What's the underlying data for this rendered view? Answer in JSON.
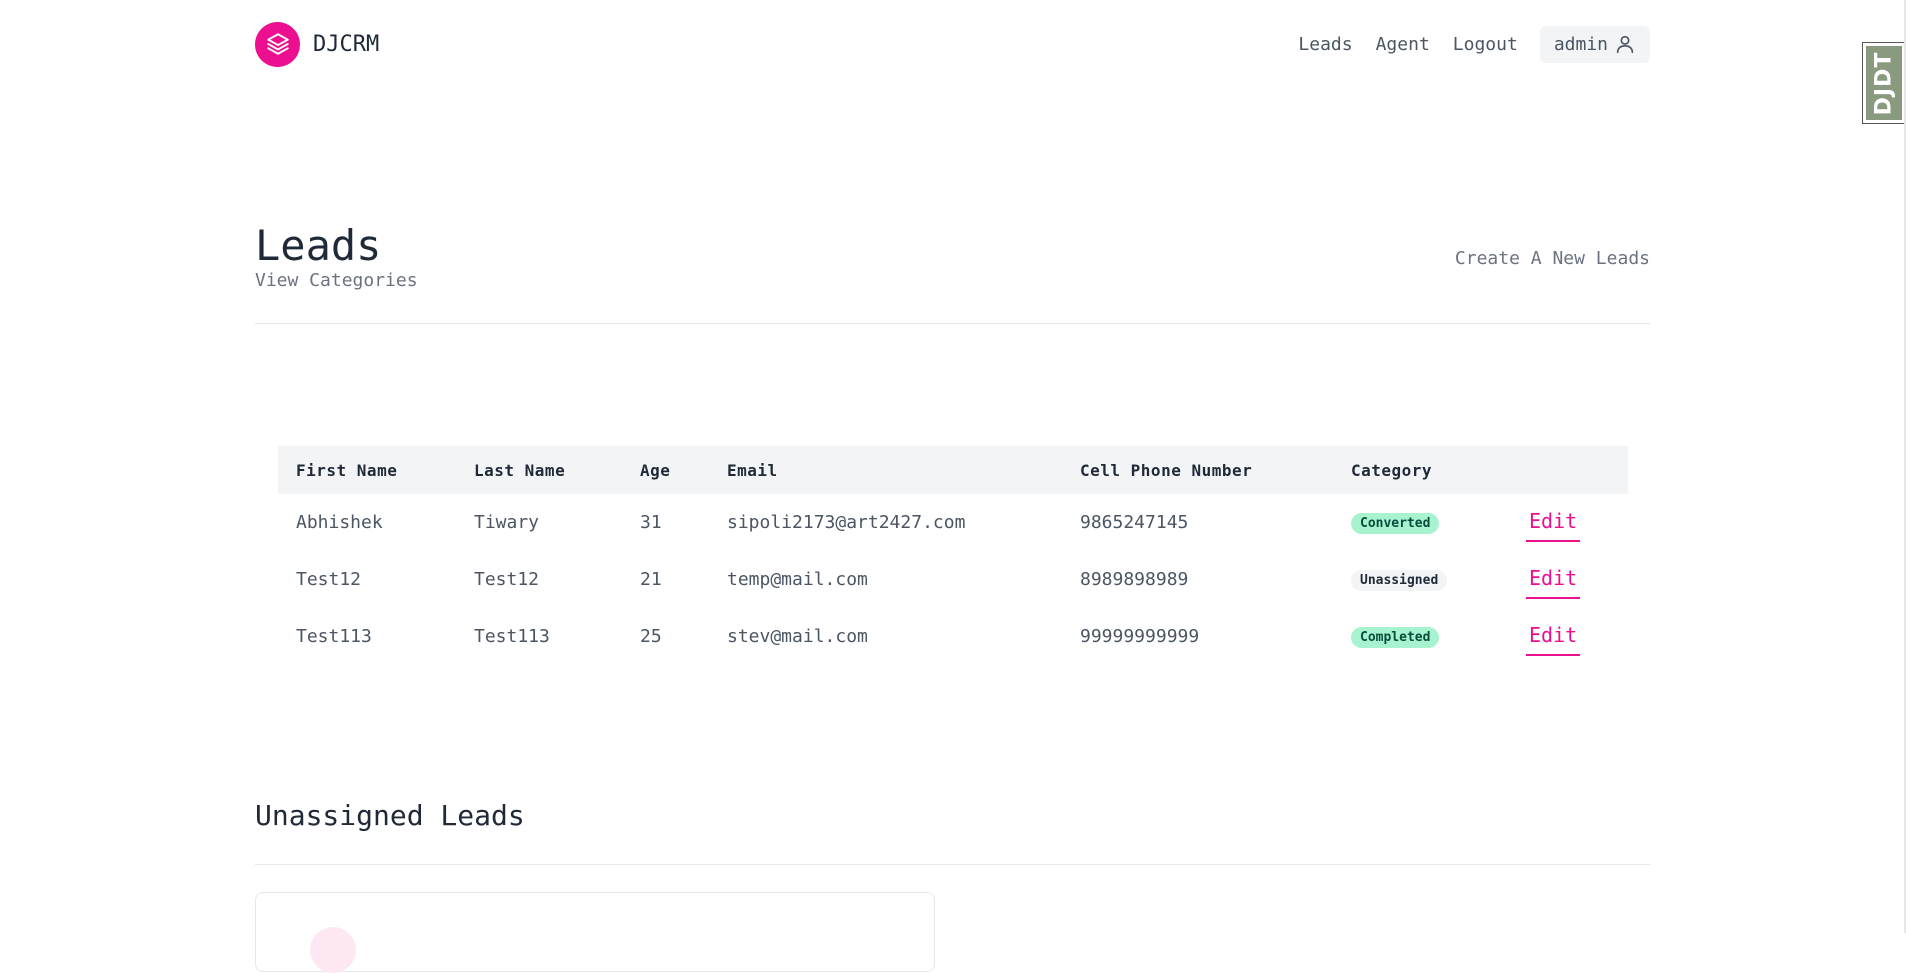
{
  "header": {
    "brand": "DJCRM",
    "nav": {
      "leads": "Leads",
      "agent": "Agent",
      "logout": "Logout"
    },
    "user": "admin",
    "icons": {
      "logo": "layers-icon",
      "user": "user-icon"
    }
  },
  "djdt": {
    "label": "DJDT"
  },
  "page": {
    "title": "Leads",
    "view_categories": "View Categories",
    "create_link": "Create A New Leads"
  },
  "table": {
    "columns": [
      "First Name",
      "Last Name",
      "Age",
      "Email",
      "Cell Phone Number",
      "Category"
    ],
    "edit_label": "Edit",
    "rows": [
      {
        "first_name": "Abhishek",
        "last_name": "Tiwary",
        "age": "31",
        "email": "sipoli2173@art2427.com",
        "phone": "9865247145",
        "category": "Converted"
      },
      {
        "first_name": "Test12",
        "last_name": "Test12",
        "age": "21",
        "email": "temp@mail.com",
        "phone": "8989898989",
        "category": "Unassigned"
      },
      {
        "first_name": "Test113",
        "last_name": "Test113",
        "age": "25",
        "email": "stev@mail.com",
        "phone": "99999999999",
        "category": "Completed"
      }
    ]
  },
  "unassigned": {
    "title": "Unassigned Leads"
  },
  "colors": {
    "accent": "#ec0f8f",
    "badge_green": "#a7f3d0",
    "badge_gray": "#f3f4f6",
    "header_bg": "#f3f4f6"
  }
}
